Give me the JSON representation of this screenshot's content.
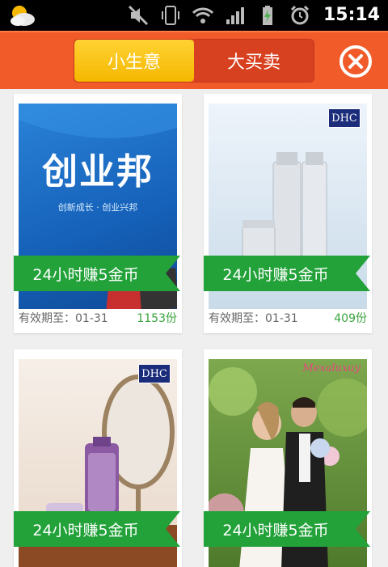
{
  "status_bar": {
    "time": "15:14",
    "icons": [
      "weather-icon",
      "mute-icon",
      "vibrate-icon",
      "wifi-icon",
      "signal-icon",
      "battery-charging-icon",
      "alarm-icon"
    ]
  },
  "header": {
    "tabs": [
      {
        "label": "小生意",
        "active": true
      },
      {
        "label": "大买卖",
        "active": false
      }
    ],
    "close_icon": "close-circle-icon"
  },
  "colors": {
    "header_bg": "#f15a29",
    "tab_active": "#f8c21a",
    "tab_inactive": "#d8411f",
    "ribbon": "#23a23a",
    "count_text": "#3aa33d"
  },
  "cards": [
    {
      "title_image": "创业邦",
      "subtitle_image": "创新成长 · 创业兴邦",
      "ribbon": "24小时赚5金币",
      "expiry": "有效期至：01-31",
      "count": "1153份"
    },
    {
      "title_image": "DHC",
      "ribbon": "24小时赚5金币",
      "expiry": "有效期至：01-31",
      "count": "409份"
    },
    {
      "title_image": "DHC",
      "ribbon": "24小时赚5金币"
    },
    {
      "title_image": "Mexaluxuy",
      "ribbon": "24小时赚5金币"
    }
  ]
}
